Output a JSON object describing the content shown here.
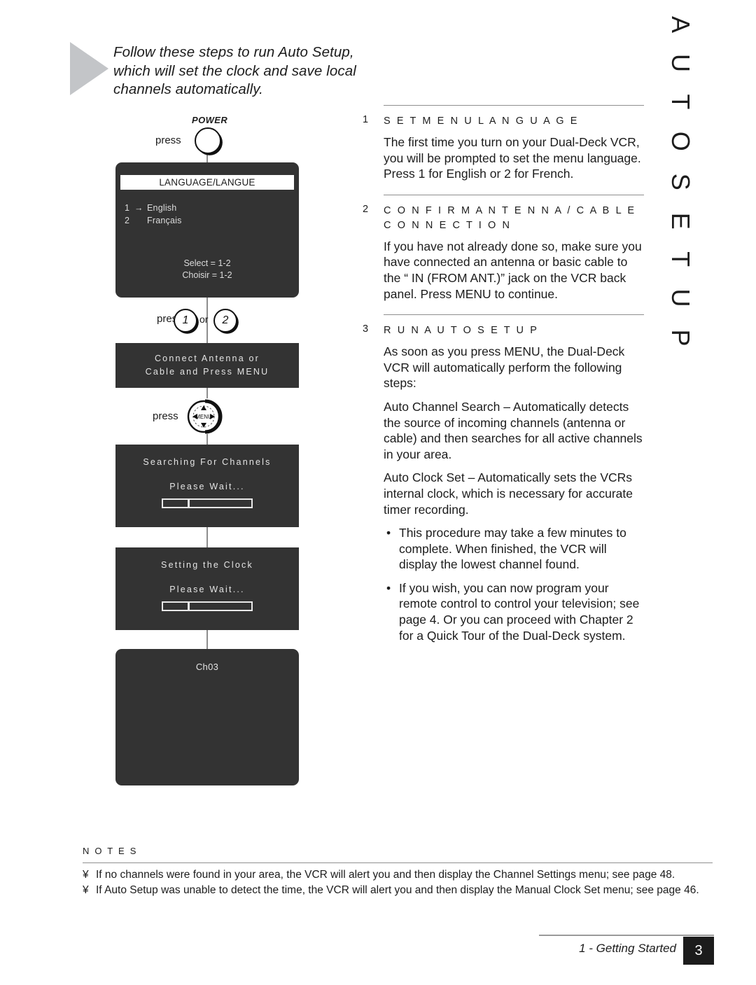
{
  "intro": {
    "text": "Follow these steps to run Auto Setup, which will set the clock and save local channels automatically."
  },
  "chapter": {
    "title": "A U T O   S E T U P"
  },
  "flow": {
    "power": {
      "press_label": "press",
      "button_label": "POWER"
    },
    "screen_language": {
      "title": "LANGUAGE/LANGUE",
      "option_1_num": "1",
      "option_1_arrow": "→",
      "option_1_name": "English",
      "option_2_num": "2",
      "option_2_arrow": "",
      "option_2_name": "Français",
      "select_en": "Select = 1-2",
      "select_fr": "Choisir = 1-2"
    },
    "numkeys": {
      "press_label": "press",
      "key_1": "1",
      "or_label": "or",
      "key_2": "2"
    },
    "screen_antenna": {
      "line_1": "Connect Antenna or",
      "line_2": "Cable and Press MENU"
    },
    "menu": {
      "press_label": "press",
      "button_label": "MENU"
    },
    "screen_searching": {
      "heading": "Searching For Channels",
      "wait": "Please Wait..."
    },
    "screen_clock": {
      "heading": "Setting the Clock",
      "wait": "Please Wait..."
    },
    "screen_channel": {
      "channel": "Ch03"
    }
  },
  "content": {
    "steps": [
      {
        "number": "1",
        "title": "S E T   M E N U   L A N G U A G E",
        "paragraphs": [
          "The first time you turn on your Dual-Deck VCR, you will be prompted to set the menu language. Press 1 for English or 2 for French."
        ]
      },
      {
        "number": "2",
        "title": "C O N F I R M   A N T E N N A / C A B L E C O N N E C T I O N",
        "paragraphs": [
          "If you have not already done so, make sure you have connected an antenna or basic cable to the “ IN (FROM ANT.)” jack on the VCR back panel. Press MENU to continue."
        ]
      },
      {
        "number": "3",
        "title": "R U N   A U T O   S E T U P",
        "paragraphs": [
          "As soon as you press MENU, the Dual-Deck VCR will automatically perform the following steps:",
          "Auto Channel Search – Automatically detects the source of incoming channels (antenna or cable) and then searches for all active channels in your area.",
          "Auto Clock Set – Automatically sets the VCRs internal clock, which is necessary for accurate timer recording."
        ],
        "bullets": [
          "This procedure may take a few minutes to complete. When finished, the VCR will display the lowest channel found.",
          "If you wish, you can now program your remote control to control your television; see page 4. Or you can proceed with Chapter 2 for a Quick Tour of the Dual-Deck system."
        ],
        "bullet_mark": "•"
      }
    ]
  },
  "notes": {
    "label": "N O T E S",
    "mark": "¥",
    "items": [
      "If no channels were found in your area, the VCR will alert you and then display the  Channel Settings menu; see page 48.",
      "If Auto Setup was unable to detect the time, the VCR will alert you and then display the Manual Clock Set menu; see page 46."
    ]
  },
  "footer": {
    "chapter_text": "1 - Getting Started",
    "page_number": "3"
  },
  "colors": {
    "screen_bg": "#333333",
    "arrow_gray": "#c3c5c8",
    "rule_gray": "#8f8f8f",
    "text": "#1c1c1c"
  }
}
